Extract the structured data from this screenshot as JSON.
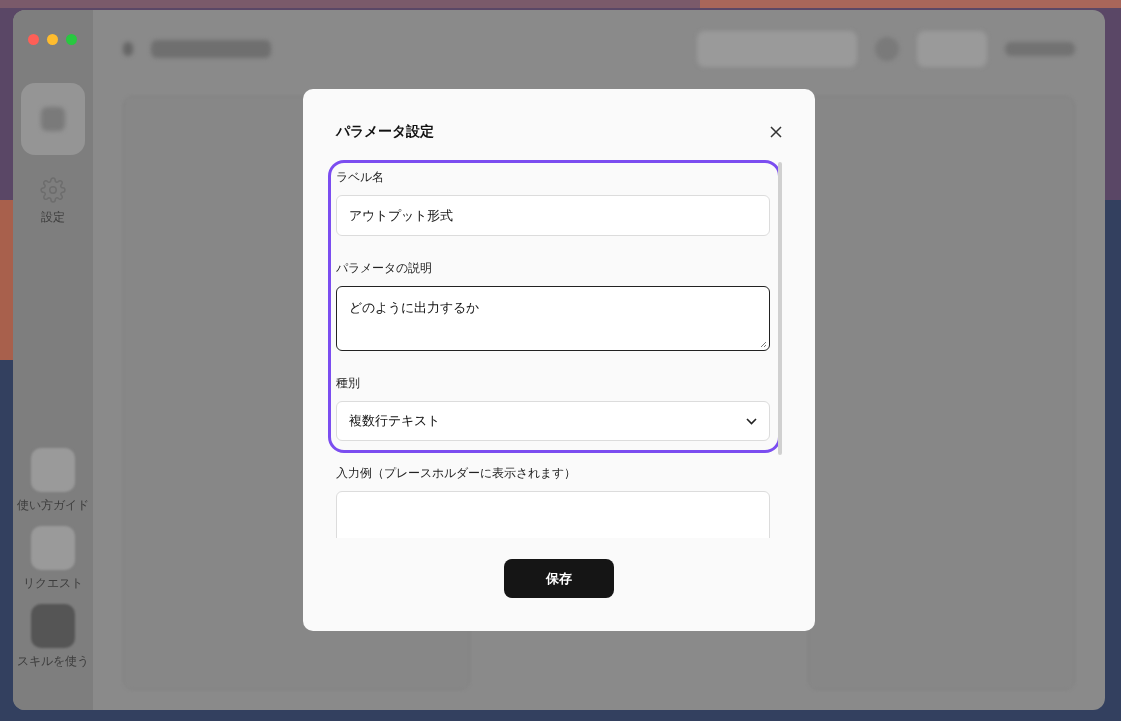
{
  "sidebar": {
    "items": [
      {
        "kind": "blurred",
        "selected": true
      },
      {
        "kind": "settings",
        "label": "設定",
        "selected": false
      }
    ],
    "bottom_items": [
      {
        "label": "使い方ガイド",
        "filled": false
      },
      {
        "label": "リクエスト",
        "filled": false
      },
      {
        "label": "スキルを使う",
        "filled": true
      }
    ]
  },
  "dialog": {
    "title": "パラメータ設定",
    "fields": [
      {
        "kind": "text",
        "label": "ラベル名",
        "value": "アウトプット形式",
        "focused": false,
        "highlighted": true
      },
      {
        "kind": "textarea",
        "label": "パラメータの説明",
        "value": "どのように出力するか",
        "focused": true,
        "highlighted": true
      },
      {
        "kind": "select",
        "label": "種別",
        "value": "複数行テキスト",
        "focused": false,
        "highlighted": true
      },
      {
        "kind": "textarea",
        "label": "入力例（プレースホルダーに表示されます）",
        "focused": false,
        "highlighted": false
      }
    ],
    "save_button": "保存"
  }
}
